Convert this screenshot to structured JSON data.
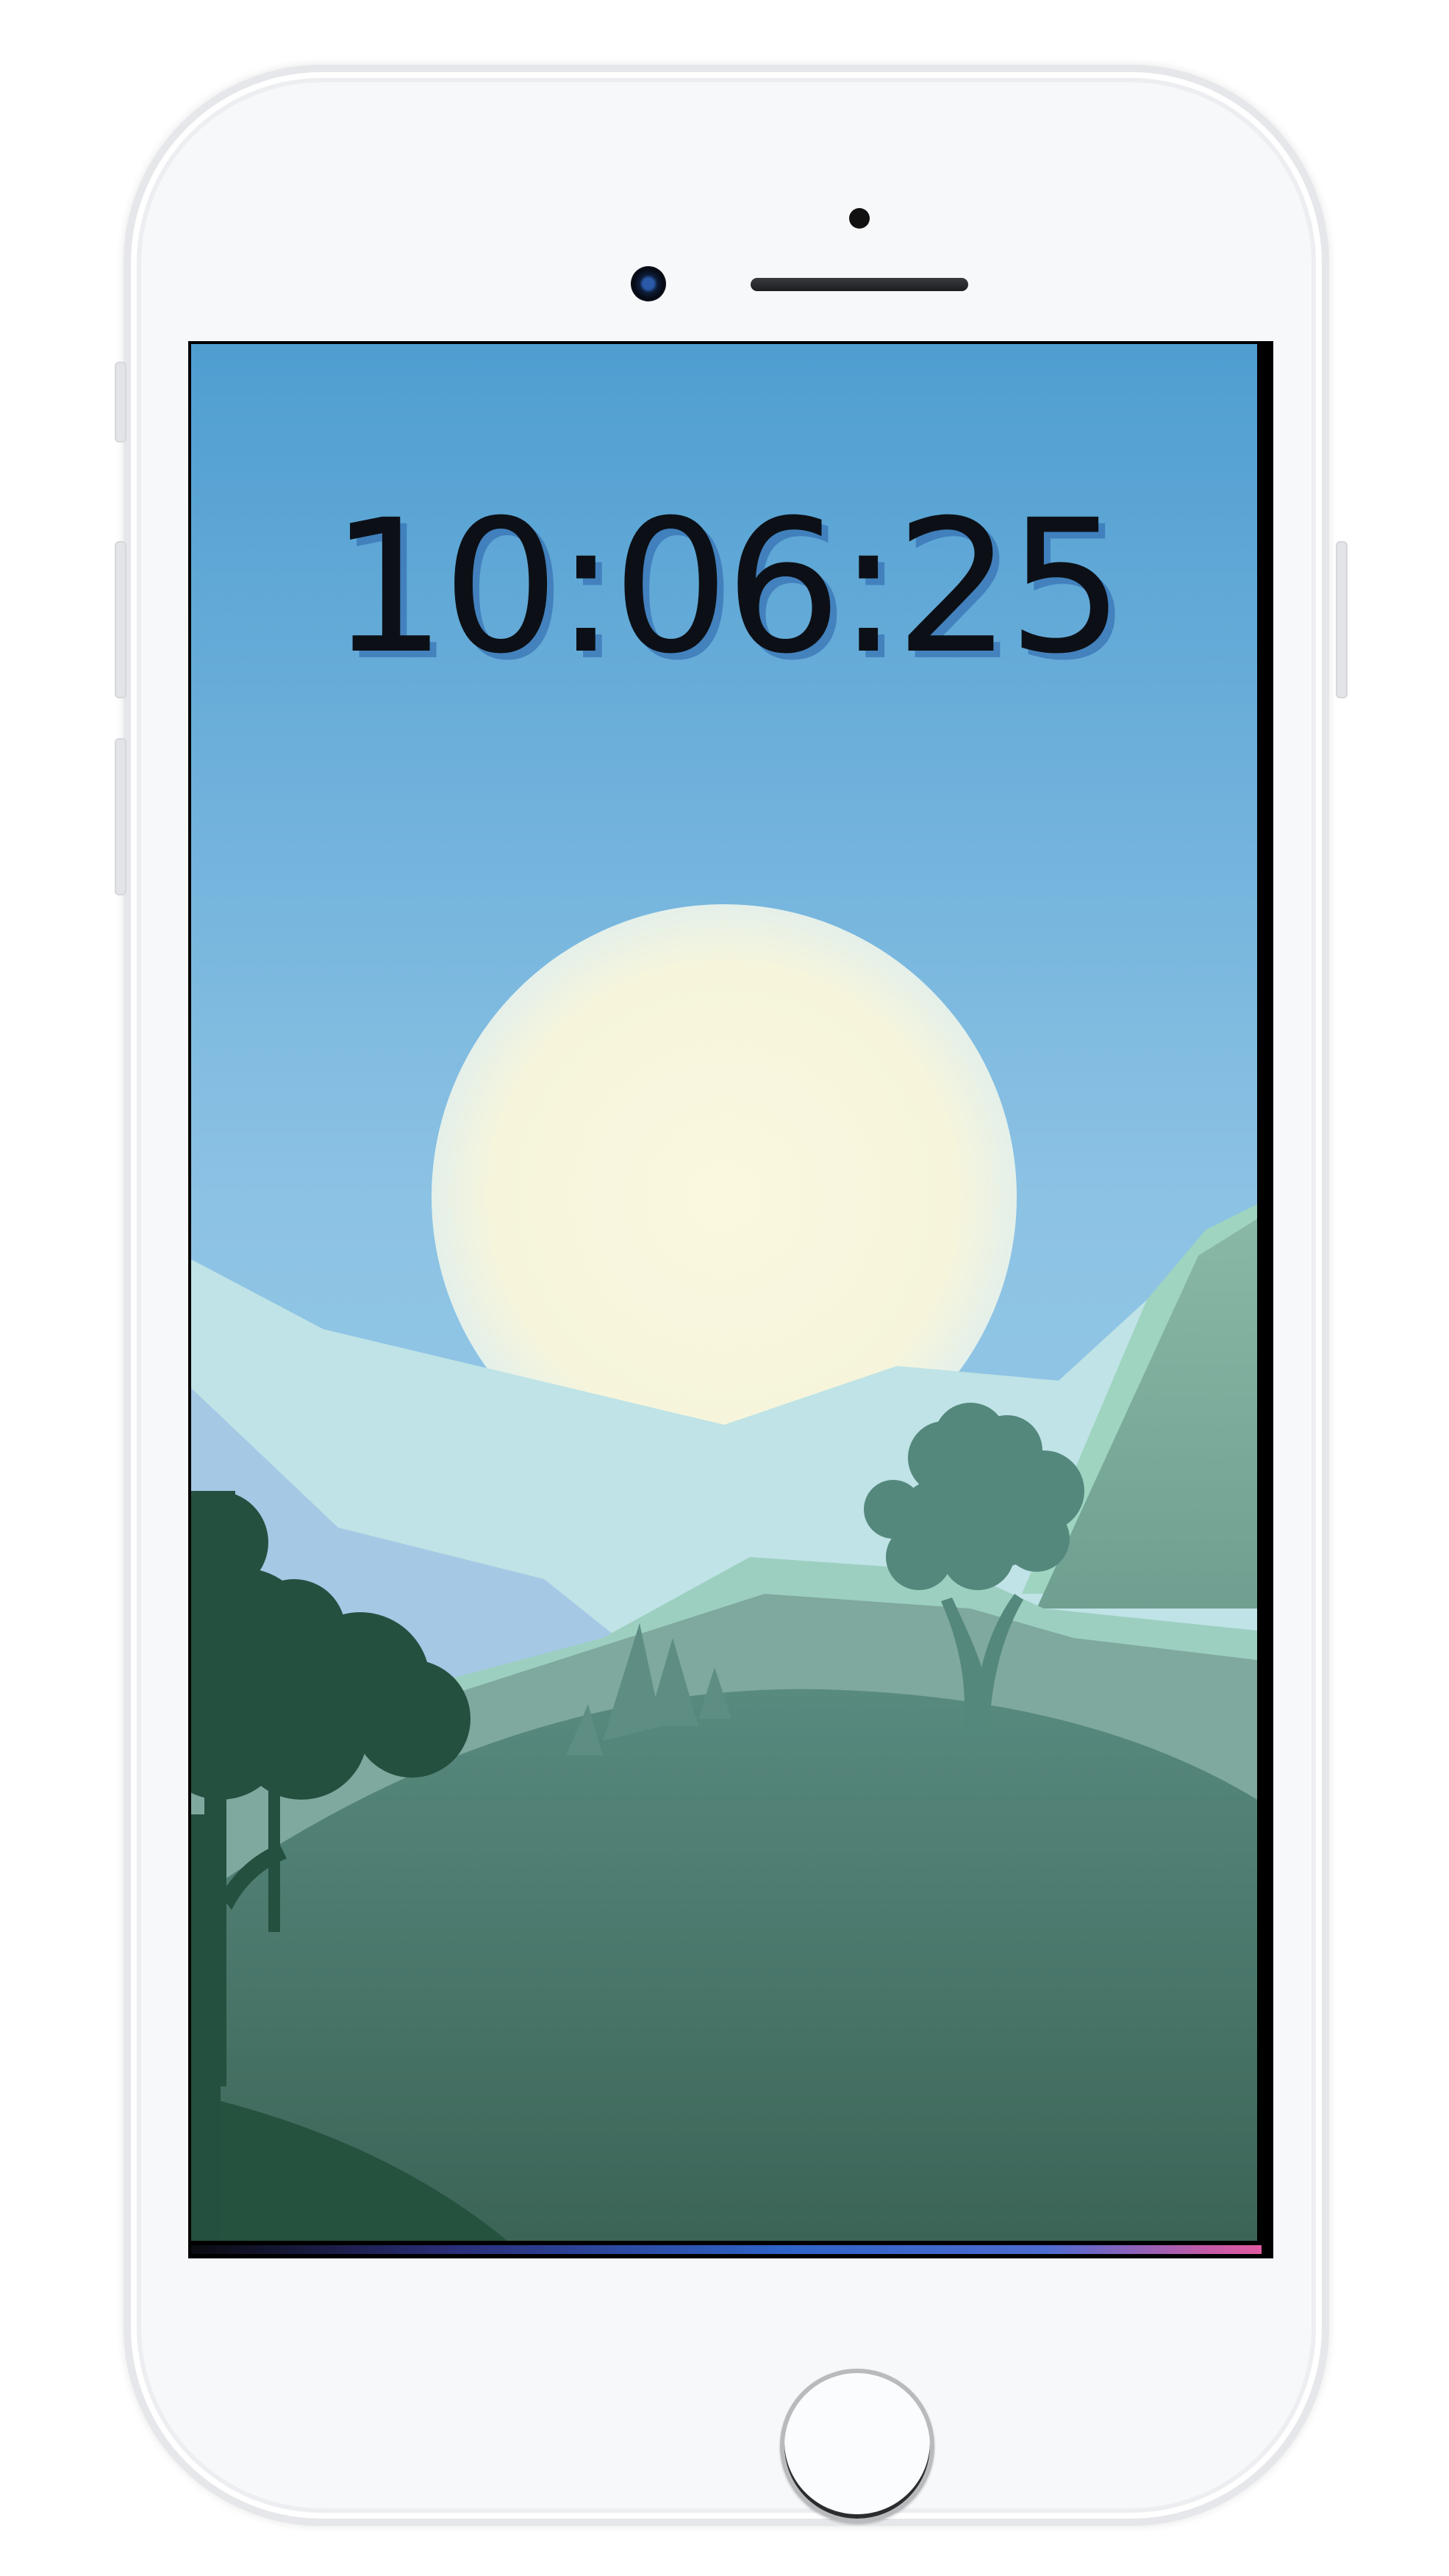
{
  "device": {
    "model": "smartphone",
    "color": "#f7f8fa"
  },
  "lock_screen": {
    "time": "10:06:25",
    "wallpaper": "landscape-sunrise",
    "colors": {
      "sky_top": "#4f9ed1",
      "sky_bottom": "#8cc2e4",
      "sun": "#faf8dc",
      "hill_dark": "#25513f",
      "hill_mid": "#4f8174",
      "tree": "#55887d"
    }
  },
  "icons": {
    "front_camera": "camera-icon",
    "home_button": "home-button-icon"
  }
}
